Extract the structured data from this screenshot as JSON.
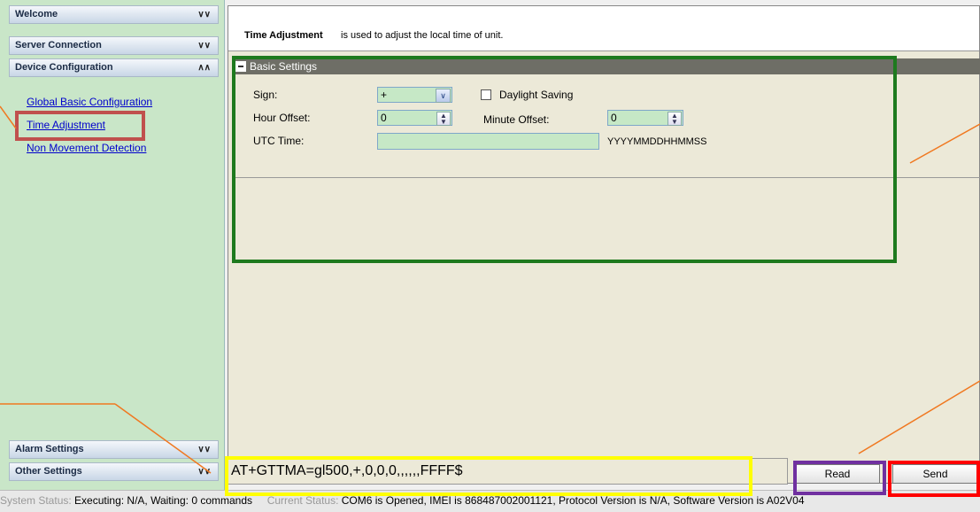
{
  "sidebar": {
    "welcome": "Welcome",
    "server_connection": "Server Connection",
    "device_configuration": "Device Configuration",
    "links": [
      "Global Basic Configuration",
      "Time Adjustment",
      "Non Movement Detection"
    ],
    "alarm_settings": "Alarm Settings",
    "other_settings": "Other Settings"
  },
  "main": {
    "desc_bold": "Time Adjustment",
    "desc_rest": "is used to adjust the local time of unit.",
    "group_title": "Basic Settings",
    "fields": {
      "sign_label": "Sign:",
      "sign_value": "+",
      "daylight_label": "Daylight Saving",
      "hour_label": "Hour Offset:",
      "hour_value": "0",
      "minute_label": "Minute Offset:",
      "minute_value": "0",
      "utc_label": "UTC Time:",
      "utc_value": "",
      "utc_hint": "YYYYMMDDHHMMSS"
    }
  },
  "command": "AT+GTTMA=gl500,+,0,0,0,,,,,,FFFF$",
  "buttons": {
    "read": "Read",
    "send": "Send"
  },
  "status": {
    "system_label": "System Status:",
    "system_value": "Executing: N/A, Waiting: 0 commands",
    "current_label": "Current Status:",
    "current_value": "COM6 is Opened, IMEI is 868487002001121, Protocol Version is N/A, Software Version is A02V04"
  },
  "annotation_colors": {
    "green": "#1e7a1e",
    "red_link": "#c0504d",
    "yellow": "#ffff00",
    "purple": "#7030a0",
    "red_send": "#ff0000",
    "orange_line": "#f07820"
  }
}
